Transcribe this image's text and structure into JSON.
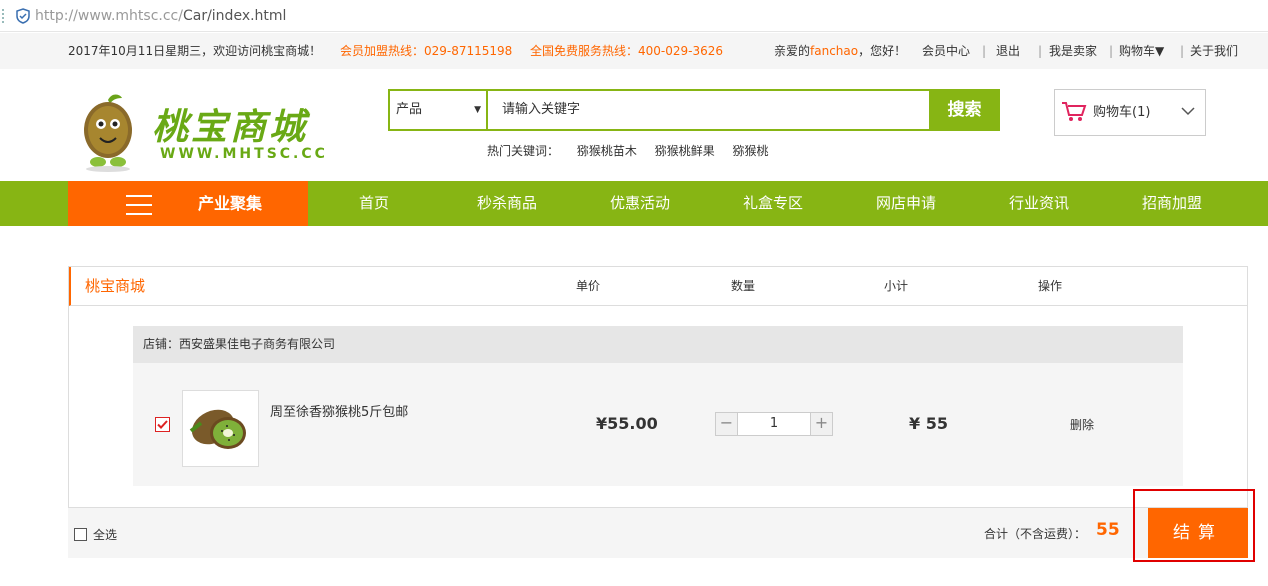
{
  "browser": {
    "url_prefix": "http://www.mhtsc.cc/",
    "url_path": "Car/index.html"
  },
  "topbar": {
    "date_welcome": "2017年10月11日星期三，欢迎访问桃宝商城！",
    "hotline_member": "会员加盟热线：029-87115198",
    "hotline_service": "全国免费服务热线：400-029-3626",
    "greeting_prefix": "亲爱的",
    "username": "fanchao",
    "greeting_suffix": "，您好！",
    "links": [
      "会员中心",
      "退出",
      "我是卖家",
      "购物车▼",
      "关于我们"
    ]
  },
  "header": {
    "logo_title": "桃宝商城",
    "logo_url": "WWW.MHTSC.CC",
    "search": {
      "category": "产品",
      "placeholder": "请输入关键字",
      "button": "搜索"
    },
    "hot_label": "热门关键词：",
    "hot_keywords": [
      "猕猴桃苗木",
      "猕猴桃鲜果",
      "猕猴桃"
    ],
    "cart": "购物车(1)"
  },
  "nav": {
    "category": "产业聚集",
    "items": [
      "首页",
      "秒杀商品",
      "优惠活动",
      "礼盒专区",
      "网店申请",
      "行业资讯",
      "招商加盟"
    ]
  },
  "cart_table": {
    "shop_label": "桃宝商城",
    "columns": [
      "单价",
      "数量",
      "小计",
      "操作"
    ],
    "store": "店铺：西安盛果佳电子商务有限公司",
    "items": [
      {
        "name": "周至徐香猕猴桃5斤包邮",
        "price": "¥55.00",
        "qty": "1",
        "subtotal": "¥ 55",
        "action": "删除",
        "checked": true
      }
    ],
    "select_all": "全选",
    "total_label": "合计（不含运费）：",
    "total": "55",
    "checkout": "结算"
  },
  "colors": {
    "green": "#87b514",
    "orange": "#ff6600"
  }
}
